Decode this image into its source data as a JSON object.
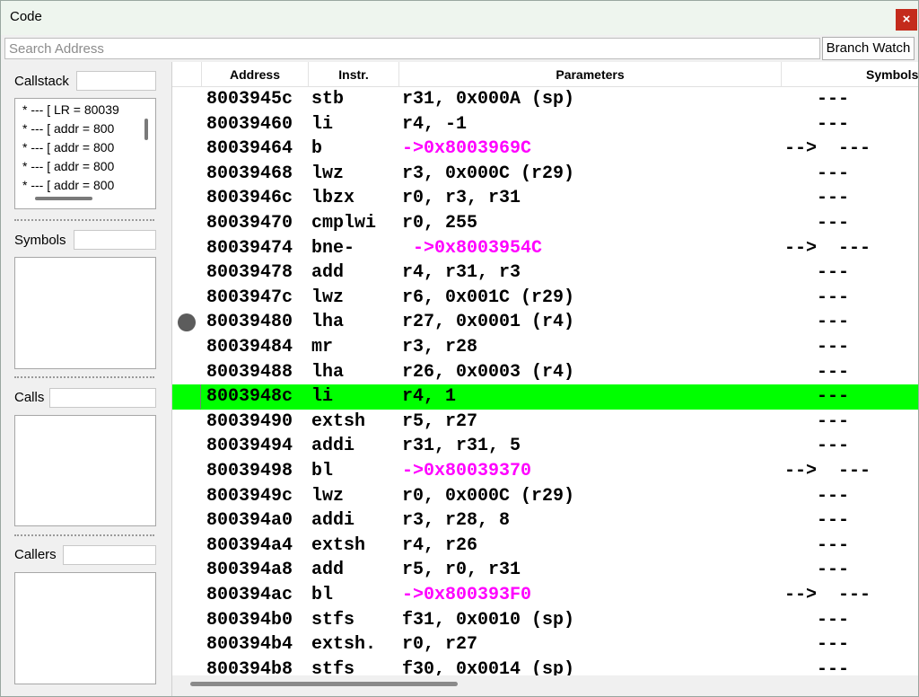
{
  "window": {
    "title": "Code",
    "close_glyph": "×"
  },
  "search": {
    "placeholder": "Search Address",
    "value": ""
  },
  "branch_watch_label": "Branch Watch",
  "sidebar": {
    "callstack_label": "Callstack",
    "callstack_items": [
      "*  ---  [ LR = 80039",
      "*  ---  [ addr = 800",
      "*  ---  [ addr = 800",
      "*  ---  [ addr = 800",
      "*  ---  [ addr = 800"
    ],
    "symbols_label": "Symbols",
    "calls_label": "Calls",
    "callers_label": "Callers"
  },
  "table": {
    "headers": {
      "address": "Address",
      "instr": "Instr.",
      "params": "Parameters",
      "symbol": "Symbols"
    },
    "branch_color": "#ff00ff",
    "current_row_color": "#00ff00",
    "rows": [
      {
        "addr": "8003945c",
        "instr": "stb",
        "params": "r31, 0x000A (sp)",
        "sym": "   ---",
        "branch": false,
        "current": false,
        "bp": false
      },
      {
        "addr": "80039460",
        "instr": "li",
        "params": "r4, -1",
        "sym": "   ---",
        "branch": false,
        "current": false,
        "bp": false
      },
      {
        "addr": "80039464",
        "instr": "b",
        "params": "->0x8003969C",
        "sym": "-->  ---",
        "branch": true,
        "current": false,
        "bp": false
      },
      {
        "addr": "80039468",
        "instr": "lwz",
        "params": "r3, 0x000C (r29)",
        "sym": "   ---",
        "branch": false,
        "current": false,
        "bp": false
      },
      {
        "addr": "8003946c",
        "instr": "lbzx",
        "params": "r0, r3, r31",
        "sym": "   ---",
        "branch": false,
        "current": false,
        "bp": false
      },
      {
        "addr": "80039470",
        "instr": "cmplwi",
        "params": "r0, 255",
        "sym": "   ---",
        "branch": false,
        "current": false,
        "bp": false
      },
      {
        "addr": "80039474",
        "instr": "bne-",
        "params": " ->0x8003954C",
        "sym": "-->  ---",
        "branch": true,
        "current": false,
        "bp": false
      },
      {
        "addr": "80039478",
        "instr": "add",
        "params": "r4, r31, r3",
        "sym": "   ---",
        "branch": false,
        "current": false,
        "bp": false
      },
      {
        "addr": "8003947c",
        "instr": "lwz",
        "params": "r6, 0x001C (r29)",
        "sym": "   ---",
        "branch": false,
        "current": false,
        "bp": false
      },
      {
        "addr": "80039480",
        "instr": "lha",
        "params": "r27, 0x0001 (r4)",
        "sym": "   ---",
        "branch": false,
        "current": false,
        "bp": true
      },
      {
        "addr": "80039484",
        "instr": "mr",
        "params": "r3, r28",
        "sym": "   ---",
        "branch": false,
        "current": false,
        "bp": false
      },
      {
        "addr": "80039488",
        "instr": "lha",
        "params": "r26, 0x0003 (r4)",
        "sym": "   ---",
        "branch": false,
        "current": false,
        "bp": false
      },
      {
        "addr": "8003948c",
        "instr": "li",
        "params": "r4, 1",
        "sym": "   ---",
        "branch": false,
        "current": true,
        "bp": false
      },
      {
        "addr": "80039490",
        "instr": "extsh",
        "params": "r5, r27",
        "sym": "   ---",
        "branch": false,
        "current": false,
        "bp": false
      },
      {
        "addr": "80039494",
        "instr": "addi",
        "params": "r31, r31, 5",
        "sym": "   ---",
        "branch": false,
        "current": false,
        "bp": false
      },
      {
        "addr": "80039498",
        "instr": "bl",
        "params": "->0x80039370",
        "sym": "-->  ---",
        "branch": true,
        "current": false,
        "bp": false
      },
      {
        "addr": "8003949c",
        "instr": "lwz",
        "params": "r0, 0x000C (r29)",
        "sym": "   ---",
        "branch": false,
        "current": false,
        "bp": false
      },
      {
        "addr": "800394a0",
        "instr": "addi",
        "params": "r3, r28, 8",
        "sym": "   ---",
        "branch": false,
        "current": false,
        "bp": false
      },
      {
        "addr": "800394a4",
        "instr": "extsh",
        "params": "r4, r26",
        "sym": "   ---",
        "branch": false,
        "current": false,
        "bp": false
      },
      {
        "addr": "800394a8",
        "instr": "add",
        "params": "r5, r0, r31",
        "sym": "   ---",
        "branch": false,
        "current": false,
        "bp": false
      },
      {
        "addr": "800394ac",
        "instr": "bl",
        "params": "->0x800393F0",
        "sym": "-->  ---",
        "branch": true,
        "current": false,
        "bp": false
      },
      {
        "addr": "800394b0",
        "instr": "stfs",
        "params": "f31, 0x0010 (sp)",
        "sym": "   ---",
        "branch": false,
        "current": false,
        "bp": false
      },
      {
        "addr": "800394b4",
        "instr": "extsh.",
        "params": "r0, r27",
        "sym": "   ---",
        "branch": false,
        "current": false,
        "bp": false
      },
      {
        "addr": "800394b8",
        "instr": "stfs",
        "params": "f30, 0x0014 (sp)",
        "sym": "   ---",
        "branch": false,
        "current": false,
        "bp": false
      }
    ]
  }
}
